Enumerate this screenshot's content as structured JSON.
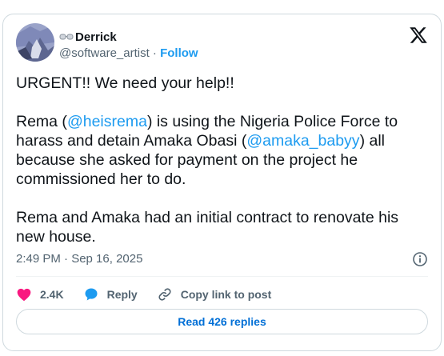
{
  "author": {
    "display_name": "Derrick",
    "handle": "@software_artist",
    "separator": " · ",
    "follow_label": "Follow"
  },
  "tweet": {
    "line1": "URGENT!! We need your help!!",
    "p2_a": "Rema (",
    "p2_mention1": "@heisrema",
    "p2_b": ") is using the Nigeria Police Force to harass and detain Amaka Obasi (",
    "p2_mention2": "@amaka_babyy",
    "p2_c": ")  all because she asked for payment on the project he commissioned her to do.",
    "p3": "Rema and Amaka had an initial contract to renovate his new house."
  },
  "timestamp": "2:49 PM · Sep 16, 2025",
  "actions": {
    "likes_count": "2.4K",
    "reply_label": "Reply",
    "copy_link_label": "Copy link to post"
  },
  "read_replies_label": "Read 426 replies",
  "colors": {
    "accent": "#1d9bf0",
    "like": "#f91880",
    "muted": "#536471",
    "button_text": "#006fd6"
  },
  "icons": [
    "glasses-icon",
    "x-logo-icon",
    "info-icon",
    "heart-icon",
    "reply-bubble-icon",
    "link-icon"
  ]
}
